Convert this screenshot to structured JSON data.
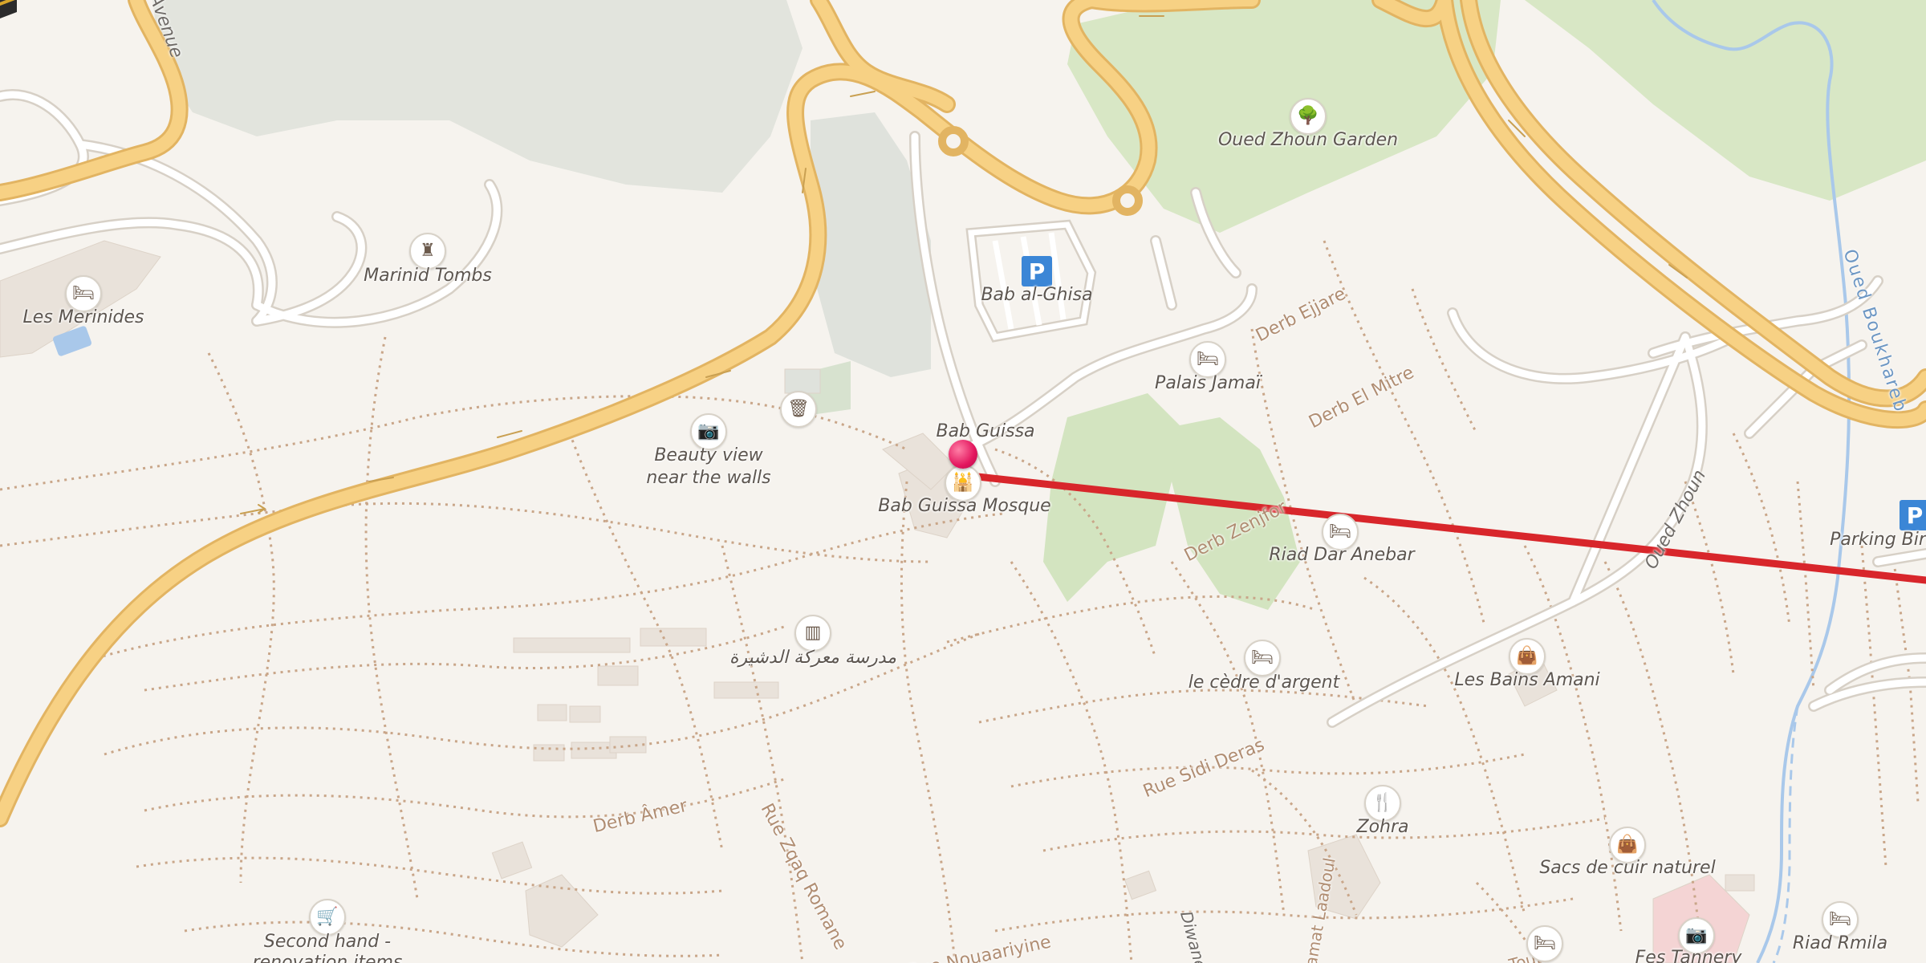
{
  "map": {
    "pois": [
      {
        "name": "Marinid Tombs",
        "icon": "castle-icon",
        "glyph": "♜",
        "tone": "dark"
      },
      {
        "name": "Les Merinides",
        "icon": "hotel-bed-icon",
        "glyph": "🛏",
        "tone": "dark"
      },
      {
        "name": "Beauty view near the walls",
        "line1": "Beauty view",
        "line2": "near the walls",
        "icon": "camera-icon",
        "glyph": "📷",
        "tone": "purple"
      },
      {
        "name": "Bab Guissa",
        "icon": "location-pin-icon"
      },
      {
        "name": "Bab Guissa Mosque",
        "icon": "mosque-icon",
        "glyph": "🕌",
        "tone": "dark"
      },
      {
        "name": "مدرسة معركة الدشيرة",
        "icon": "school-icon",
        "glyph": "▥",
        "tone": "dark"
      },
      {
        "name": "Bab al-Ghisa",
        "icon": "parking-icon",
        "glyph": "P"
      },
      {
        "name": "Palais Jamaï",
        "icon": "hotel-bed-icon",
        "glyph": "🛏",
        "tone": "dark"
      },
      {
        "name": "Oued Zhoun Garden",
        "icon": "tree-icon",
        "glyph": "🌳",
        "tone": "green"
      },
      {
        "name": "Riad Dar Anebar",
        "icon": "hotel-bed-icon",
        "glyph": "🛏",
        "tone": "dark"
      },
      {
        "name": "le cèdre d'argent",
        "icon": "hotel-bed-icon",
        "glyph": "🛏",
        "tone": "dark"
      },
      {
        "name": "Les Bains Amani",
        "icon": "shopping-bag-icon",
        "glyph": "👜",
        "tone": "purple"
      },
      {
        "name": "Zohra",
        "icon": "restaurant-icon",
        "glyph": "🍴",
        "tone": "food"
      },
      {
        "name": "Sacs de cuir naturel",
        "icon": "shopping-bag-icon",
        "glyph": "👜",
        "tone": "purple"
      },
      {
        "name": "Riad Rmila",
        "icon": "hotel-bed-icon",
        "glyph": "🛏",
        "tone": "dark"
      },
      {
        "name": "Fes Tannery",
        "icon": "camera-icon",
        "glyph": "📷",
        "tone": "purple"
      },
      {
        "name": "Second hand - renovation items",
        "line1": "Second hand -",
        "line2": "renovation items",
        "icon": "shopping-cart-icon",
        "glyph": "🛒",
        "tone": "purple"
      },
      {
        "name": "Parking Bir",
        "icon": "parking-icon",
        "glyph": "P"
      },
      {
        "name": "",
        "icon": "waste-bin-icon",
        "glyph": "🗑",
        "tone": "dark"
      },
      {
        "name": "",
        "icon": "hotel-bed-icon",
        "glyph": "🛏",
        "tone": "dark"
      }
    ],
    "streets": [
      "Derb Ejjare",
      "Derb El Mitre",
      "Derb Zenjfor",
      "Rue Sidi Deras",
      "Derb Âmer",
      "Rue Zqaq Romane",
      "Rue Nouaariyine",
      "Oued Zhoun",
      "Oued Boukhareb",
      "Avenue",
      "Lamat Laadoul",
      "Diwane",
      "Touil"
    ],
    "route": {
      "color": "#d8262b",
      "destination_icon": "kaaba-icon"
    },
    "colors": {
      "land": "#f6f3ee",
      "park": "#d9e8c7",
      "major_road": "#f7d184",
      "road_casing": "#e2b462",
      "minor_road": "#ffffff",
      "path": "#c9a689",
      "water": "#a9c8ea",
      "building": "#e9e2da",
      "wood": "#dee1da"
    }
  }
}
